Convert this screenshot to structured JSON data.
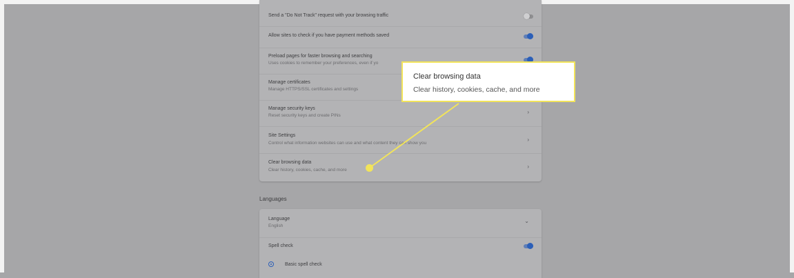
{
  "privacy_card": {
    "rows": [
      {
        "title": "Send a \"Do Not Track\" request with your browsing traffic",
        "toggle": "off"
      },
      {
        "title": "Allow sites to check if you have payment methods saved",
        "toggle": "on"
      },
      {
        "title": "Preload pages for faster browsing and searching",
        "subtitle": "Uses cookies to remember your preferences, even if yo",
        "toggle": "on"
      },
      {
        "title": "Manage certificates",
        "subtitle": "Manage HTTPS/SSL certificates and settings"
      },
      {
        "title": "Manage security keys",
        "subtitle": "Reset security keys and create PINs",
        "chevron": "›"
      },
      {
        "title": "Site Settings",
        "subtitle": "Control what information websites can use and what content they can show you",
        "chevron": "›"
      },
      {
        "title": "Clear browsing data",
        "subtitle": "Clear history, cookies, cache, and more",
        "chevron": "›"
      }
    ]
  },
  "languages": {
    "heading": "Languages",
    "language_row": {
      "title": "Language",
      "value": "English",
      "chevron": "⌄"
    },
    "spell_check_row": {
      "title": "Spell check",
      "toggle": "on"
    },
    "basic_spell_check": {
      "label": "Basic spell check",
      "selected": true
    }
  },
  "callout": {
    "title": "Clear browsing data",
    "subtitle": "Clear history, cookies, cache, and more",
    "highlight_color": "#f2e45a"
  },
  "colors": {
    "overlay_background": "#a6a6a8",
    "toggle_on": "#2b5fb8"
  }
}
